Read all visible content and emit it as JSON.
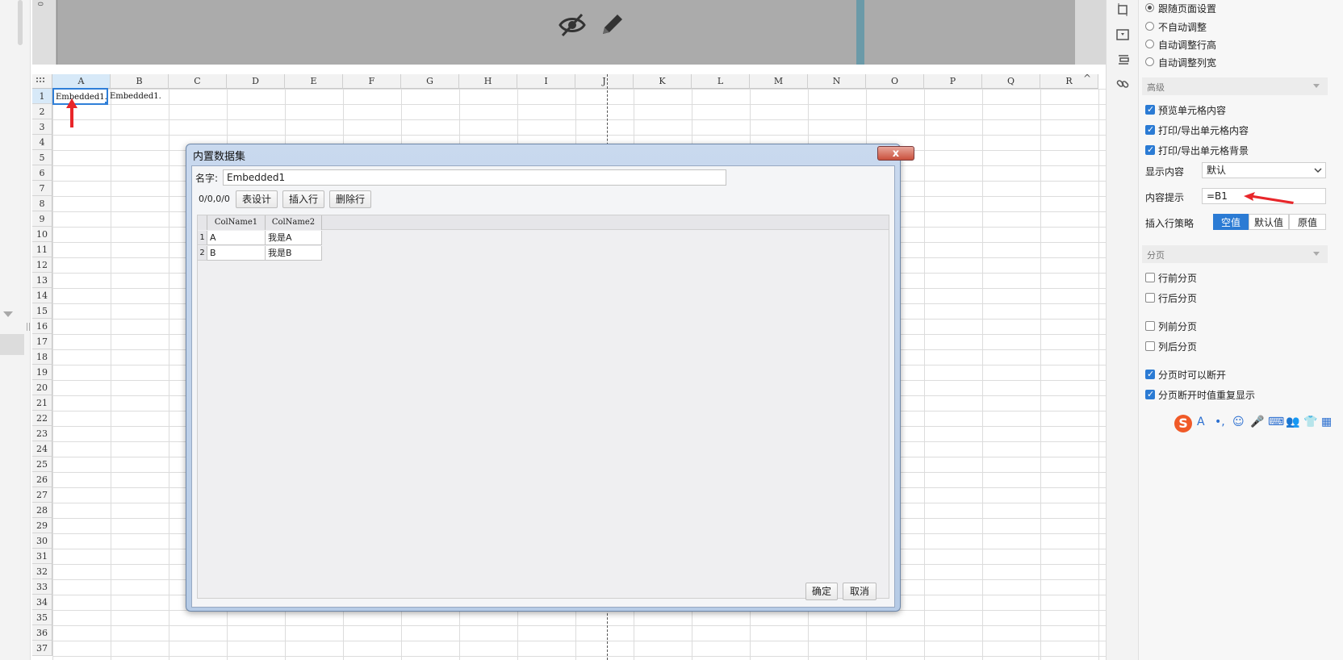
{
  "preview": {
    "ruler_label": "0"
  },
  "grid": {
    "columns": [
      "A",
      "B",
      "C",
      "D",
      "E",
      "F",
      "G",
      "H",
      "I",
      "J",
      "K",
      "L",
      "M",
      "N",
      "O",
      "P",
      "Q",
      "R"
    ],
    "rows": [
      "1",
      "2",
      "3",
      "4",
      "5",
      "6",
      "7",
      "8",
      "9",
      "10",
      "11",
      "12",
      "13",
      "14",
      "15",
      "16",
      "17",
      "18",
      "19",
      "20",
      "21",
      "22",
      "23",
      "24",
      "25",
      "26",
      "27",
      "28",
      "29",
      "30",
      "31",
      "32",
      "33",
      "34",
      "35",
      "36",
      "37"
    ],
    "cell_a1": "Embedded1.",
    "cell_b1": "Embedded1.",
    "scroll_up_glyph": "^"
  },
  "dialog": {
    "title": "内置数据集",
    "close_glyph": "x",
    "name_label": "名字:",
    "name_value": "Embedded1",
    "counter": "0/0,0/0",
    "btn_design": "表设计",
    "btn_insert": "插入行",
    "btn_delete": "删除行",
    "table": {
      "headers": [
        "ColName1",
        "ColName2"
      ],
      "rows": [
        {
          "idx": "1",
          "c1": "A",
          "c2": "我是A"
        },
        {
          "idx": "2",
          "c1": "B",
          "c2": "我是B"
        }
      ]
    },
    "btn_ok": "确定",
    "btn_cancel": "取消"
  },
  "panel": {
    "radios": [
      {
        "label": "跟随页面设置",
        "checked": true
      },
      {
        "label": "不自动调整",
        "checked": false
      },
      {
        "label": "自动调整行高",
        "checked": false
      },
      {
        "label": "自动调整列宽",
        "checked": false
      }
    ],
    "section_advanced": "高级",
    "checks_advanced": [
      {
        "label": "预览单元格内容",
        "checked": true
      },
      {
        "label": "打印/导出单元格内容",
        "checked": true
      },
      {
        "label": "打印/导出单元格背景",
        "checked": true
      }
    ],
    "display_label": "显示内容",
    "display_value": "默认",
    "tooltip_label": "内容提示",
    "tooltip_value": "=B1",
    "insert_label": "插入行策略",
    "insert_options": [
      "空值",
      "默认值",
      "原值"
    ],
    "section_paging": "分页",
    "checks_paging": [
      {
        "label": "行前分页",
        "checked": false
      },
      {
        "label": "行后分页",
        "checked": false
      },
      {
        "label": "列前分页",
        "checked": false
      },
      {
        "label": "列后分页",
        "checked": false
      },
      {
        "label": "分页时可以断开",
        "checked": true
      },
      {
        "label": "分页断开时值重复显示",
        "checked": true
      }
    ]
  },
  "ime": {
    "logo": "S",
    "glyphs": [
      "A",
      "•,",
      "☺",
      "🎤",
      "⌨",
      "👥",
      "👕",
      "▦"
    ]
  },
  "colors": {
    "accent": "#2b7bd4",
    "selection": "#2f7fd8",
    "annotation_arrow": "#e8262a"
  }
}
